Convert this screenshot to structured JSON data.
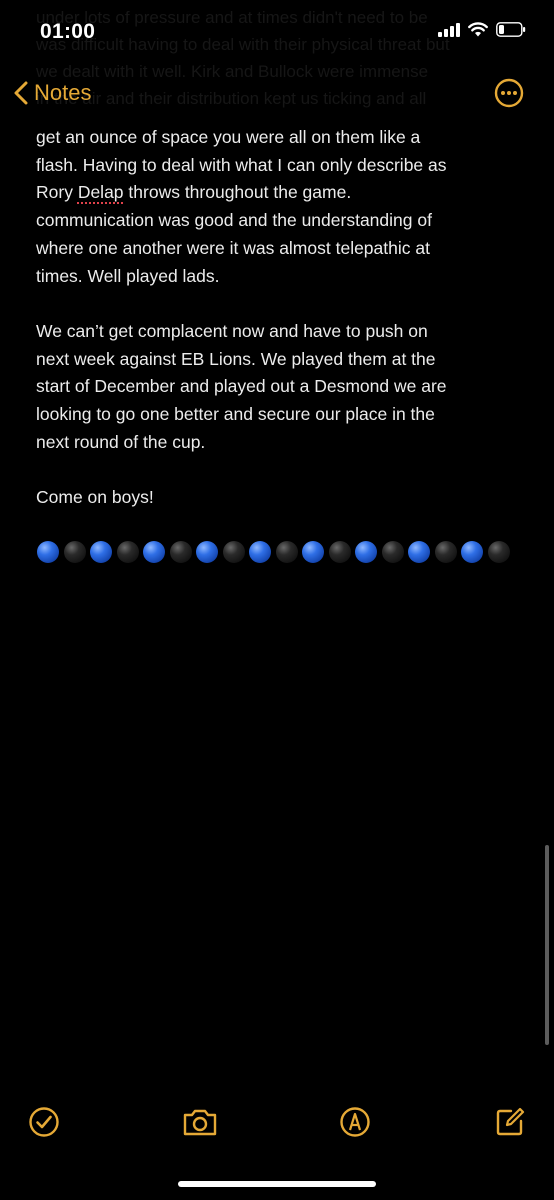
{
  "status": {
    "time": "01:00"
  },
  "nav": {
    "back_label": "Notes"
  },
  "colors": {
    "accent": "#e5a936",
    "text": "#ececec",
    "background": "#000000",
    "misspell": "#e0424b",
    "ball_blue": "#2f6fe6",
    "ball_black": "#1a1a1a"
  },
  "note": {
    "faded_lines": [
      "under lots of pressure and at times didn't need to be",
      "was difficult having to deal with their physical threat but",
      "we dealt with it well. Kirk and Bullock were immense",
      "in the air and their distribution kept us ticking and all"
    ],
    "para1_line1": "get an ounce of space you were all on them like a",
    "para1_line2": "flash. Having to deal with what I can only describe as",
    "para1_line3_pre": "Rory ",
    "para1_line3_misspelled": "Delap",
    "para1_line3_post": " throws throughout the game.",
    "para1_line4": "communication was good and the understanding of",
    "para1_line5": "where one another were it was almost telepathic at",
    "para1_line6": "times. Well played lads.",
    "para2_line1": "We can’t get complacent now and have to push on",
    "para2_line2": "next week against EB Lions. We played them at the",
    "para2_line3": "start of December and played out a Desmond we are",
    "para2_line4": "looking to go one better and secure our place in the",
    "para2_line5": "next round of the cup.",
    "para3_line1": "Come on boys!",
    "emoji_balls": [
      "blue",
      "black",
      "blue",
      "black",
      "blue",
      "black",
      "blue",
      "black",
      "blue",
      "black",
      "blue",
      "black",
      "blue",
      "black",
      "blue",
      "black",
      "blue",
      "black"
    ]
  },
  "toolbar": {
    "icons": [
      "checklist-icon",
      "camera-icon",
      "markup-icon",
      "compose-icon"
    ]
  }
}
